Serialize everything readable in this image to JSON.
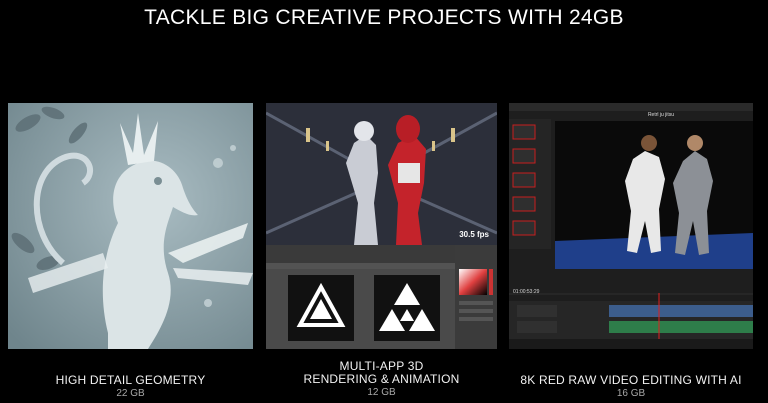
{
  "header": {
    "title": "TACKLE BIG CREATIVE PROJECTS WITH 24GB"
  },
  "panels": [
    {
      "name": "HIGH DETAIL GEOMETRY",
      "size": "22 GB"
    },
    {
      "name_line1": "MULTI-APP 3D",
      "name_line2": "RENDERING & ANIMATION",
      "size": "12 GB",
      "fps": "30.5 fps"
    },
    {
      "name": "8K RED RAW VIDEO EDITING WITH AI",
      "size": "16 GB",
      "timecode": "01:00:53:29",
      "project_title": "Retrl ju jitsu"
    }
  ],
  "icons": {
    "seahorse": "seahorse-sculpture-icon",
    "robots": "robots-render-icon",
    "emblem": "triangle-emblem-icon",
    "judo": "judo-footage-icon"
  },
  "colors": {
    "background": "#000000",
    "accent_red": "#d4202a",
    "caption_gray": "#a8a8a8"
  }
}
